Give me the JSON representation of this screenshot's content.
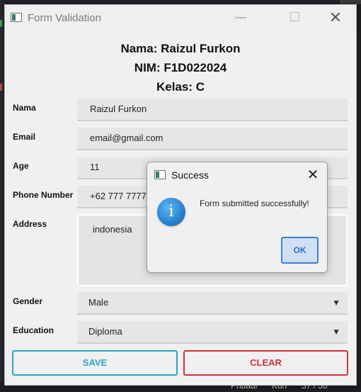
{
  "window": {
    "title": "Form Validation"
  },
  "header": {
    "name_line": "Nama: Raizul Furkon",
    "nim_line": "NIM: F1D022024",
    "class_line": "Kelas: C"
  },
  "form": {
    "name": {
      "label": "Nama",
      "value": "Raizul Furkon"
    },
    "email": {
      "label": "Email",
      "value": "email@gmail.com"
    },
    "age": {
      "label": "Age",
      "value": "11"
    },
    "phone": {
      "label": "Phone Number",
      "value": "+62 777 7777 7"
    },
    "address": {
      "label": "Address",
      "value": "indonesia"
    },
    "gender": {
      "label": "Gender",
      "selected": "Male"
    },
    "education": {
      "label": "Education",
      "selected": "Diploma"
    }
  },
  "buttons": {
    "save": "SAVE",
    "clear": "CLEAR"
  },
  "dialog": {
    "title": "Success",
    "message": "Form submitted successfully!",
    "ok": "OK",
    "icon": "info-icon"
  },
  "background": {
    "bottom_fragments": [
      "Pribadi",
      "Kun",
      "37 / 50"
    ]
  },
  "colors": {
    "save_accent": "#2ba6c4",
    "clear_accent": "#d0303e",
    "ok_accent": "#3c7fd6"
  }
}
